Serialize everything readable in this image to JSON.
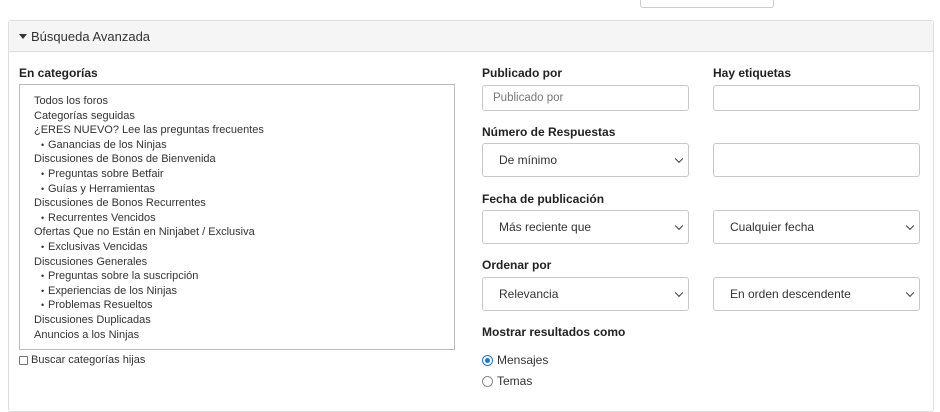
{
  "panel": {
    "title": "Búsqueda Avanzada"
  },
  "categories": {
    "label": "En categorías",
    "items": [
      {
        "label": "Todos los foros",
        "child": false
      },
      {
        "label": "Categorías seguidas",
        "child": false
      },
      {
        "label": "¿ERES NUEVO? Lee las preguntas frecuentes",
        "child": false
      },
      {
        "label": "Ganancias de los Ninjas",
        "child": true
      },
      {
        "label": "Discusiones de Bonos de Bienvenida",
        "child": false
      },
      {
        "label": "Preguntas sobre Betfair",
        "child": true
      },
      {
        "label": "Guías y Herramientas",
        "child": true
      },
      {
        "label": "Discusiones de Bonos Recurrentes",
        "child": false
      },
      {
        "label": "Recurrentes Vencidos",
        "child": true
      },
      {
        "label": "Ofertas Que no Están en Ninjabet / Exclusiva",
        "child": false
      },
      {
        "label": "Exclusivas Vencidas",
        "child": true
      },
      {
        "label": "Discusiones Generales",
        "child": false
      },
      {
        "label": "Preguntas sobre la suscripción",
        "child": true
      },
      {
        "label": "Experiencias de los Ninjas",
        "child": true
      },
      {
        "label": "Problemas Resueltos",
        "child": true
      },
      {
        "label": "Discusiones Duplicadas",
        "child": false
      },
      {
        "label": "Anuncios a los Ninjas",
        "child": false
      }
    ],
    "child_bullet": "•",
    "search_children_label": "Buscar categorías hijas"
  },
  "posted_by": {
    "label": "Publicado por",
    "placeholder": "Publicado por"
  },
  "tags": {
    "label": "Hay etiquetas",
    "value": ""
  },
  "replies": {
    "label": "Número de Respuestas",
    "selected": "De mínimo",
    "value": ""
  },
  "post_date": {
    "label": "Fecha de publicación",
    "selected": "Más reciente que",
    "date_selected": "Cualquier fecha"
  },
  "order": {
    "label": "Ordenar por",
    "selected": "Relevancia",
    "direction": "En orden descendente"
  },
  "show_results": {
    "label": "Mostrar resultados como",
    "options": [
      {
        "label": "Mensajes",
        "checked": true
      },
      {
        "label": "Temas",
        "checked": false
      }
    ]
  }
}
